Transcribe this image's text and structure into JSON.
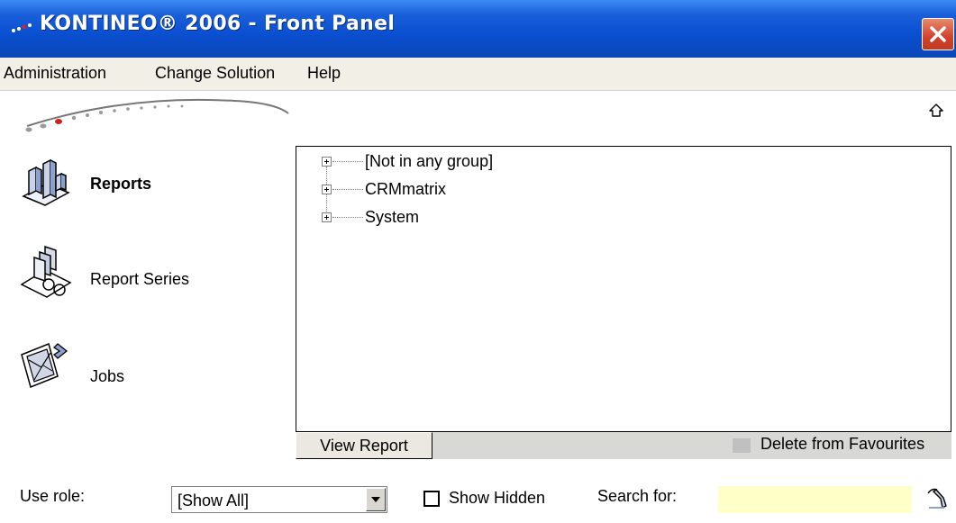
{
  "window": {
    "title": "KONTINEO® 2006 - Front Panel"
  },
  "menu": [
    {
      "label": "Administration"
    },
    {
      "label": "Change Solution"
    },
    {
      "label": "Help"
    }
  ],
  "nav": {
    "items": [
      {
        "label": "Reports",
        "icon": "reports-icon",
        "active": true
      },
      {
        "label": "Report Series",
        "icon": "report-series-icon",
        "active": false
      },
      {
        "label": "Jobs",
        "icon": "jobs-icon",
        "active": false
      }
    ]
  },
  "tree": {
    "nodes": [
      {
        "label": "[Not in any group]"
      },
      {
        "label": "CRMmatrix"
      },
      {
        "label": "System"
      }
    ]
  },
  "actions": {
    "view_report": "View Report",
    "delete_favourites": "Delete from Favourites"
  },
  "footer": {
    "use_role_label": "Use role:",
    "role_value": "[Show All]",
    "show_hidden_label": "Show Hidden",
    "show_hidden_checked": false,
    "search_label": "Search for:",
    "search_value": ""
  },
  "colors": {
    "titlebar": "#0a4fd0",
    "menubar": "#f2efe6",
    "search_bg": "#ffffc8",
    "close_button": "#d2412a"
  }
}
